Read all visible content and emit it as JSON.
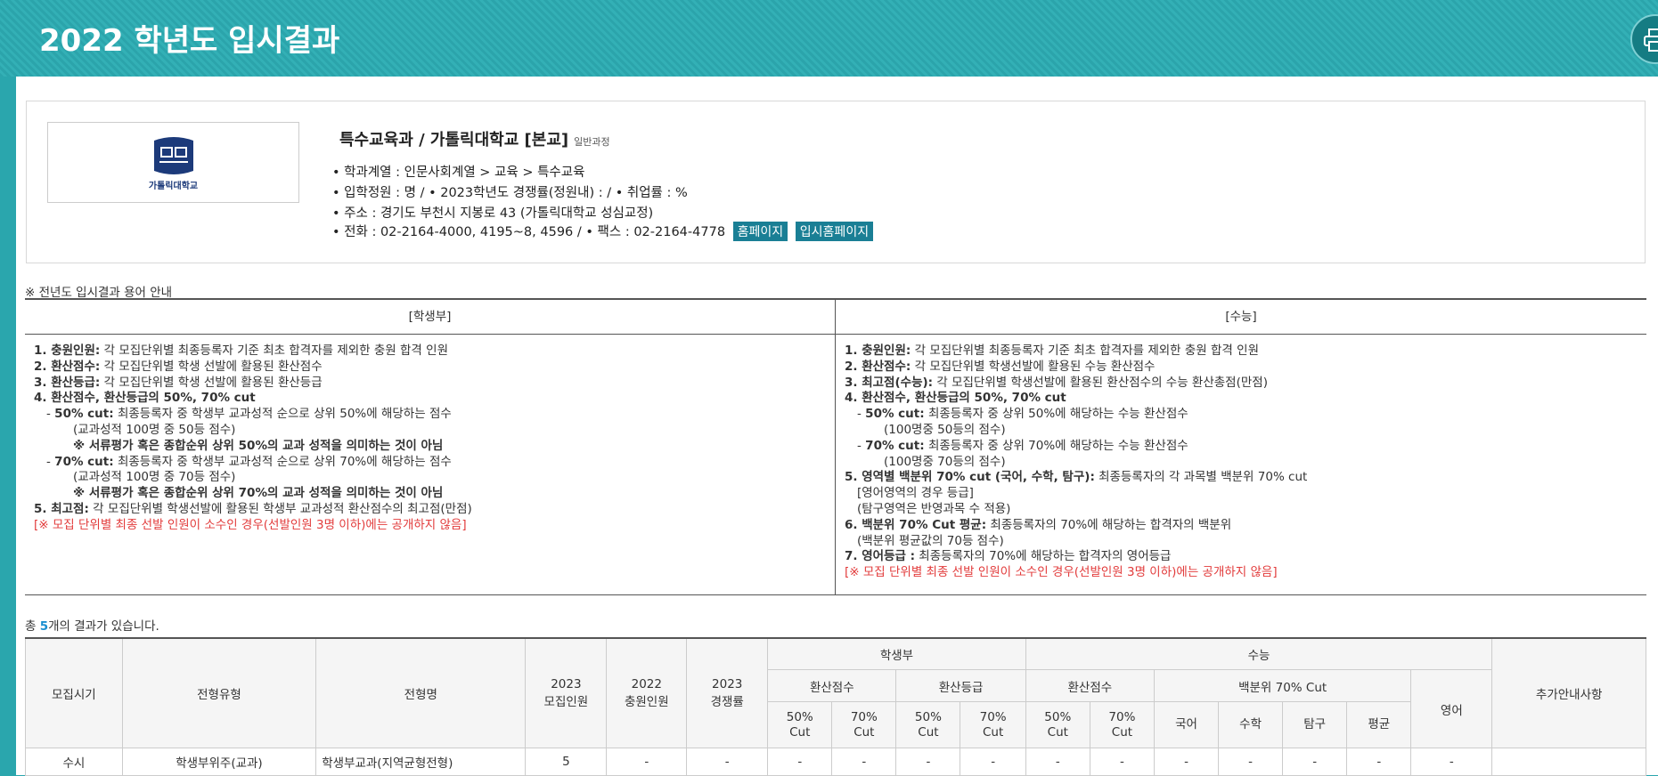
{
  "page": {
    "title": "2022 학년도 입시결과"
  },
  "univ": {
    "name": "특수교육과 / 가톨릭대학교 [본교]",
    "course": "일반과정",
    "logo_text": "가톨릭대학교",
    "line1": "• 학과계열 : 인문사회계열  > 교육  > 특수교육",
    "line2": "• 입학정원 : 명 /  • 2023학년도 경쟁률(정원내) : /  • 취업률 : %",
    "line3": "• 주소 : 경기도 부천시 지봉로 43 (가톨릭대학교 성심교정)",
    "line4": "• 전화 : 02-2164-4000, 4195~8, 4596 /  • 팩스 : 02-2164-4778",
    "homepage_label": "홈페이지",
    "admission_label": "입시홈페이지"
  },
  "guide": {
    "title": "※ 전년도 입시결과 용어 안내",
    "left_header": "[학생부]",
    "right_header": "[수능]",
    "left": [
      {
        "b": "1. 충원인원:",
        "t": " 각 모집단위별 최종등록자 기준 최초 합격자를 제외한 충원 합격 인원"
      },
      {
        "b": "2. 환산점수:",
        "t": " 각 모집단위별 학생 선발에 활용된 환산점수"
      },
      {
        "b": "3. 환산등급:",
        "t": " 각 모집단위별 학생 선발에 활용된 환산등급"
      },
      {
        "b": "4. 환산점수, 환산등급의 50%, 70% cut",
        "t": ""
      },
      {
        "pre": "- ",
        "b": "50% cut:",
        "t": " 최종등록자 중 학생부 교과성적 순으로 상위 50%에 해당하는 점수",
        "ind": 1
      },
      {
        "t": "(교과성적 100명 중 50등 점수)",
        "ind": 2
      },
      {
        "b": "※ 서류평가 혹은 종합순위 상위 50%의 교과 성적을 의미하는 것이 아님",
        "t": "",
        "ind": 2
      },
      {
        "pre": "- ",
        "b": "70% cut:",
        "t": " 최종등록자 중 학생부 교과성적 순으로 상위 70%에 해당하는 점수",
        "ind": 1
      },
      {
        "t": "(교과성적 100명 중 70등 점수)",
        "ind": 2
      },
      {
        "b": "※ 서류평가 혹은 종합순위 상위 70%의 교과 성적을 의미하는 것이 아님",
        "t": "",
        "ind": 2
      },
      {
        "b": "5. 최고점:",
        "t": " 각 모집단위별 학생선발에 활용된 학생부 교과성적 환산점수의 최고점(만점)"
      },
      {
        "r": "[※ 모집 단위별 최종 선발 인원이 소수인 경우(선발인원 3명 이하)에는 공개하지 않음]"
      }
    ],
    "right": [
      {
        "b": "1. 충원인원:",
        "t": " 각 모집단위별 최종등록자 기준 최초 합격자를 제외한 충원 합격 인원"
      },
      {
        "b": "2. 환산점수:",
        "t": " 각 모집단위별 학생선발에 활용된 수능 환산점수"
      },
      {
        "b": "3. 최고점(수능):",
        "t": " 각 모집단위별 학생선발에 활용된 환산점수의 수능 환산총점(만점)"
      },
      {
        "b": "4. 환산점수, 환산등급의 50%, 70% cut",
        "t": ""
      },
      {
        "pre": "- ",
        "b": "50% cut:",
        "t": " 최종등록자 중 상위 50%에 해당하는 수능 환산점수",
        "ind": 1
      },
      {
        "t": "(100명중 50등의 점수)",
        "ind": 2
      },
      {
        "pre": "- ",
        "b": "70% cut:",
        "t": " 최종등록자 중 상위 70%에 해당하는 수능 환산점수",
        "ind": 1
      },
      {
        "t": "(100명중 70등의 점수)",
        "ind": 2
      },
      {
        "b": "5. 영역별 백분위 70% cut (국어, 수학, 탐구):",
        "t": " 최종등록자의 각 과목별 백분위 70% cut"
      },
      {
        "t": "[영어영역의 경우 등급]",
        "ind": 1
      },
      {
        "t": "(탐구영역은 반영과목 수 적용)",
        "ind": 1
      },
      {
        "b": "6. 백분위 70% Cut 평균:",
        "t": " 최종등록자의 70%에 해당하는 합격자의 백분위"
      },
      {
        "t": "(백분위 평균값의 70등 점수)",
        "ind": 1
      },
      {
        "b": "7. 영어등급 :",
        "t": " 최종등록자의 70%에 해당하는 합격자의 영어등급"
      },
      {
        "r": "[※ 모집 단위별 최종 선발 인원이 소수인 경우(선발인원 3명 이하)에는 공개하지 않음]"
      }
    ]
  },
  "results": {
    "count_prefix": "총 ",
    "count": "5",
    "count_suffix": "개의 결과가 있습니다.",
    "headers": {
      "period": "모집시기",
      "type": "전형유형",
      "name": "전형명",
      "quota_2023": "2023\n모집인원",
      "added_2022": "2022\n충원인원",
      "ratio_2023": "2023\n경쟁률",
      "student": "학생부",
      "suneung": "수능",
      "conv_score": "환산점수",
      "conv_grade": "환산등급",
      "conv_score_s": "환산점수",
      "pct70": "백분위 70% Cut",
      "english": "영어",
      "extra": "추가안내사항",
      "cut50": "50%\nCut",
      "cut70": "70%\nCut",
      "korean": "국어",
      "math": "수학",
      "inquiry": "탐구",
      "avg": "평균"
    },
    "rows": [
      {
        "period": "수시",
        "type": "학생부위주(교과)",
        "name": "학생부교과(지역균형전형)",
        "quota": "5",
        "added": "-",
        "ratio": "-",
        "cells": [
          "-",
          "-",
          "-",
          "-",
          "-",
          "-",
          "-",
          "-",
          "-",
          "-",
          "-"
        ],
        "extra": ""
      }
    ]
  }
}
